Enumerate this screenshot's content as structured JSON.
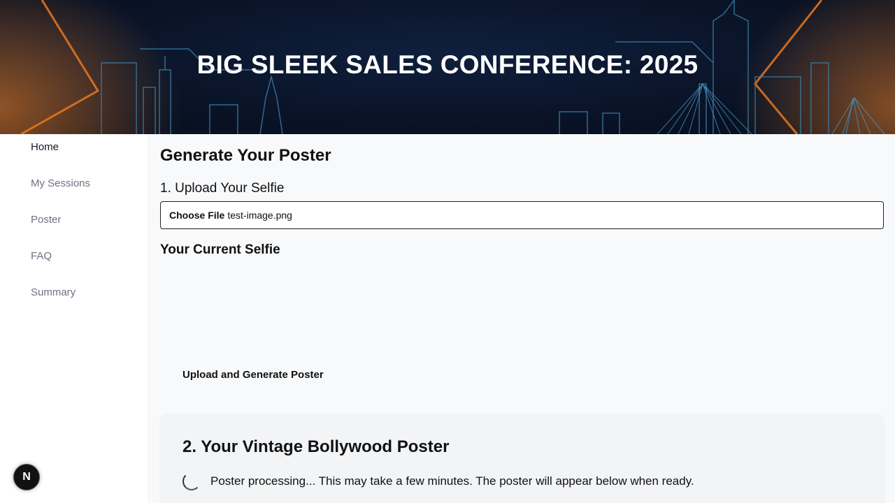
{
  "header": {
    "title": "BIG SLEEK SALES CONFERENCE: 2025"
  },
  "sidebar": {
    "items": [
      {
        "label": "Home",
        "active": true
      },
      {
        "label": "My Sessions"
      },
      {
        "label": "Poster"
      },
      {
        "label": "FAQ"
      },
      {
        "label": "Summary"
      }
    ],
    "badge": "N"
  },
  "main": {
    "page_title": "Generate Your Poster",
    "step1_title": "1. Upload Your Selfie",
    "file_button": "Choose File",
    "file_name": "test-image.png",
    "current_selfie_title": "Your Current Selfie",
    "upload_button": "Upload and Generate Poster",
    "poster_card": {
      "title": "2. Your Vintage Bollywood Poster",
      "status": "Poster processing... This may take a few minutes. The poster will appear below when ready."
    }
  },
  "colors": {
    "header_bg": "#0a1428",
    "accent_orange": "#e8781e",
    "skyline": "#3a7fa8"
  }
}
